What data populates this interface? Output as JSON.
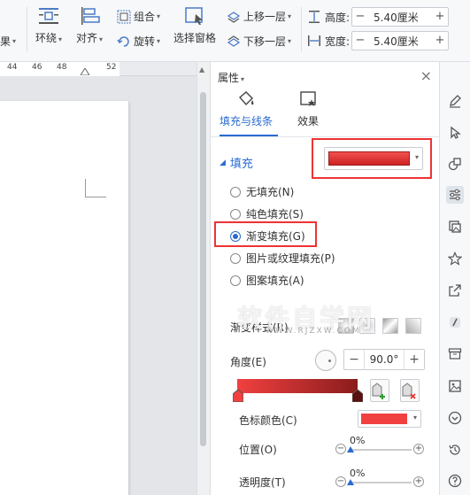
{
  "toolbar": {
    "partial_left": "果",
    "surround": "环绕",
    "align": "对齐",
    "group": "组合",
    "rotate": "旋转",
    "select_pane": "选择窗格",
    "bring_forward": "上移一层",
    "send_backward": "下移一层",
    "height_label": "高度:",
    "height_value": "5.40厘米",
    "width_label": "宽度:",
    "width_value": "5.40厘米",
    "minus": "−",
    "plus": "+"
  },
  "ruler": {
    "ticks": [
      "44",
      "46",
      "48",
      "52"
    ]
  },
  "panel": {
    "title": "属性",
    "close": "×",
    "tabs": [
      {
        "label": "填充与线条",
        "active": true
      },
      {
        "label": "效果",
        "active": false
      }
    ],
    "fill_section": "填充",
    "fill_color": "#e23434",
    "fill_options": [
      {
        "label": "无填充(N)",
        "selected": false
      },
      {
        "label": "纯色填充(S)",
        "selected": false
      },
      {
        "label": "渐变填充(G)",
        "selected": true
      },
      {
        "label": "图片或纹理填充(P)",
        "selected": false
      },
      {
        "label": "图案填充(A)",
        "selected": false
      }
    ],
    "gradient_style_label": "渐变样式(R)",
    "angle_label": "角度(E)",
    "angle_value": "90.0°",
    "gradient_start": "#f14040",
    "gradient_end": "#8a1c1c",
    "stop_color_label": "色标颜色(C)",
    "stop_color": "#f14040",
    "position_label": "位置(O)",
    "position_value": "0%",
    "transparency_label": "透明度(T)",
    "transparency_value": "0%"
  },
  "watermark": {
    "text": "软件自学网",
    "sub": "WWW.RJZXW.COM"
  },
  "colors": {
    "accent": "#2a6bd2",
    "highlight": "#ee3333"
  }
}
